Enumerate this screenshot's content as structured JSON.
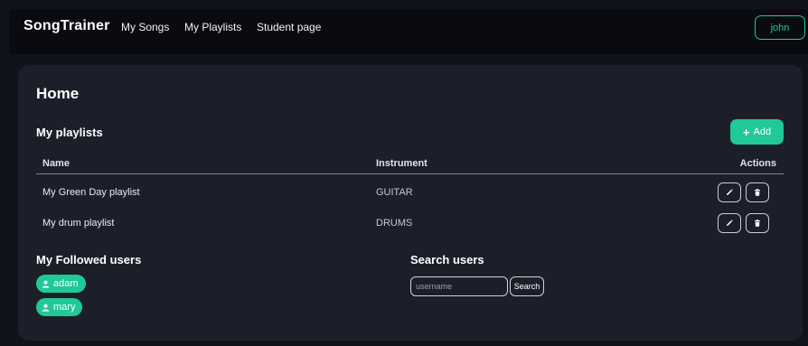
{
  "navbar": {
    "brand": "SongTrainer",
    "links": [
      "My Songs",
      "My Playlists",
      "Student page"
    ],
    "user": "john"
  },
  "page": {
    "title": "Home"
  },
  "playlists": {
    "title": "My playlists",
    "add_label": "Add",
    "columns": [
      "Name",
      "Instrument",
      "Actions"
    ],
    "rows": [
      {
        "name": "My Green Day playlist",
        "instrument": "GUITAR"
      },
      {
        "name": "My drum playlist",
        "instrument": "DRUMS"
      }
    ]
  },
  "followed": {
    "title": "My Followed users",
    "users": [
      "adam",
      "mary"
    ]
  },
  "search": {
    "title": "Search users",
    "placeholder": "username",
    "button_label": "Search"
  },
  "colors": {
    "accent": "#20c997",
    "background": "#11131a",
    "card": "#1c1f2a",
    "navbar": "#0a0b10"
  },
  "icons": {
    "edit": "pencil-icon",
    "delete": "trash-icon",
    "add": "plus-icon",
    "user": "user-icon"
  }
}
